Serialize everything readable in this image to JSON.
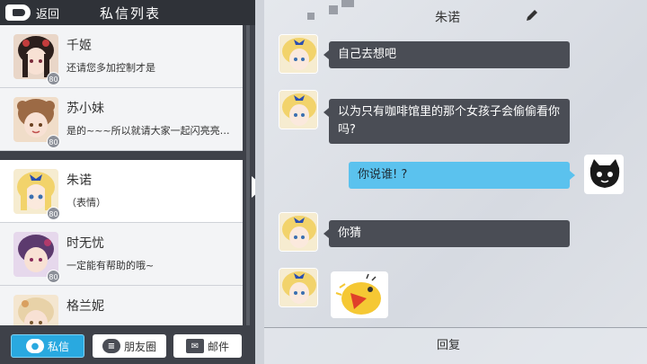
{
  "left_panel": {
    "back_label": "返回",
    "title": "私信列表",
    "contacts": [
      {
        "name": "千姬",
        "preview": "还请您多加控制才是",
        "level": "80",
        "hair": "#2c1f1c",
        "skin": "#f8e1d4",
        "accent": "#c43c3c"
      },
      {
        "name": "苏小妹",
        "preview": "是的~~~所以就请大家一起闪亮亮…",
        "level": "80",
        "hair": "#9c6a45",
        "skin": "#f8e1d4",
        "accent": "#e0a060"
      },
      {
        "name": "朱诺",
        "preview": "（表情）",
        "level": "80",
        "hair": "#f2d36b",
        "skin": "#fbe9dd",
        "accent": "#2b4fb0"
      },
      {
        "name": "时无忧",
        "preview": "一定能有帮助的哦~",
        "level": "80",
        "hair": "#5c3a6e",
        "skin": "#f8e1d4",
        "accent": "#b03a6b"
      },
      {
        "name": "格兰妮",
        "preview": "",
        "level": "80",
        "hair": "#e8d2a8",
        "skin": "#f8e1d4",
        "accent": "#d9a060"
      }
    ],
    "nav": {
      "messages_label": "私信",
      "friends_label": "朋友圈",
      "mail_label": "邮件"
    }
  },
  "chat": {
    "title": "朱诺",
    "messages": [
      {
        "from": "them",
        "text": "自己去想吧"
      },
      {
        "from": "them",
        "text": "以为只有咖啡馆里的那个女孩子会偷偷看你吗?"
      },
      {
        "from": "me",
        "text": "你说谁! ?"
      },
      {
        "from": "them",
        "text": "你猜"
      },
      {
        "from": "them",
        "sticker": "yellow-creature-sticker"
      }
    ],
    "reply_label": "回复"
  },
  "colors": {
    "accent_blue": "#29a9e0",
    "bubble_dark": "#4a4d55",
    "bubble_blue": "#5bc2ee",
    "panel_dark": "#3e4149"
  }
}
